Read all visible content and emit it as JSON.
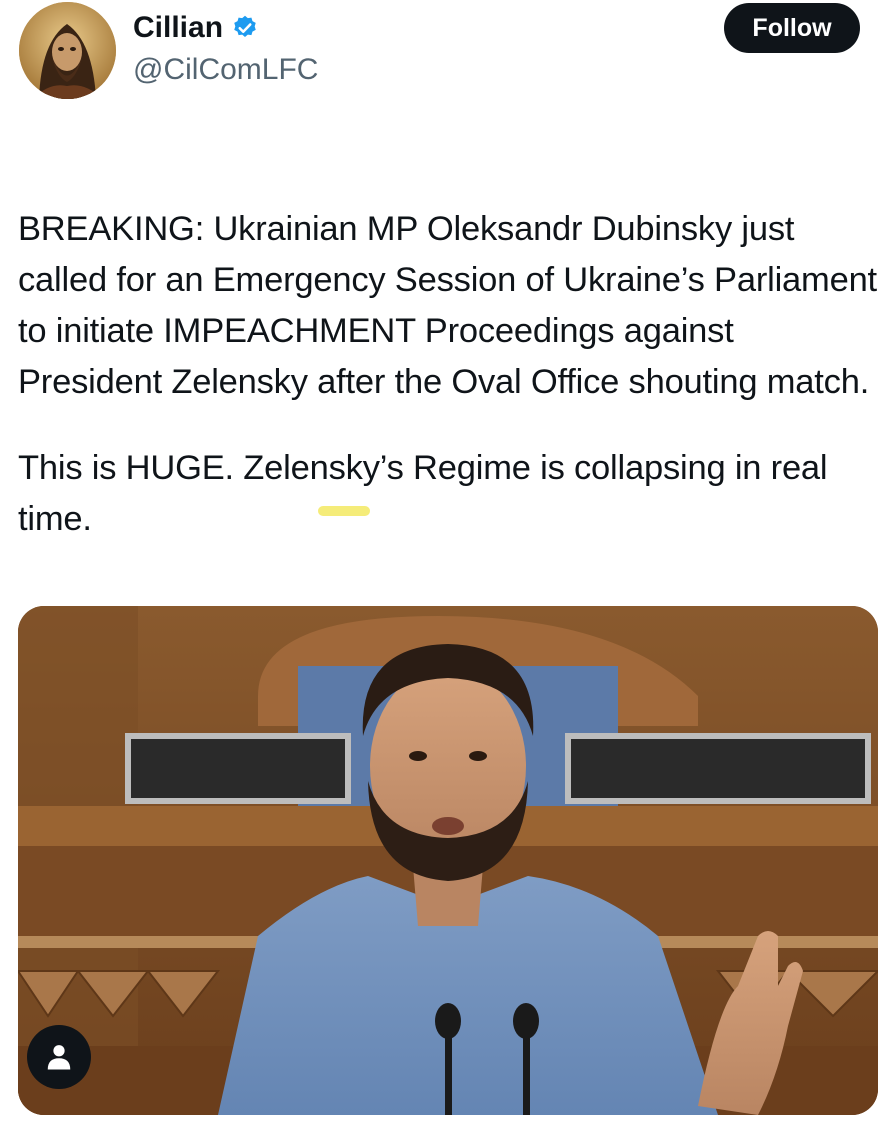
{
  "user": {
    "display_name": "Cillian",
    "handle": "@CilComLFC",
    "verified": true,
    "avatar_icon": "avatar-icon"
  },
  "follow_button": {
    "label": "Follow"
  },
  "tweet": {
    "flag_icon": "ukraine-flag-icon",
    "paragraph_1": "BREAKING: Ukrainian MP Oleksandr Dubinsky just called for an Emergency Session of Ukraine’s Parliament to initiate IMPEACHMENT Proceedings against President Zelensky after the Oval Office shouting match.",
    "paragraph_2": "This is HUGE. Zelensky’s Regime is collapsing in real time."
  },
  "media": {
    "tag_icon": "person-tag-icon"
  },
  "colors": {
    "text": "#0f1419",
    "secondary_text": "#536471",
    "verified_blue": "#1d9bf0",
    "button_bg": "#0f1419",
    "flag_blue": "#2e6fc9",
    "flag_yellow": "#f2c21c",
    "highlight": "#f4ea6a"
  }
}
